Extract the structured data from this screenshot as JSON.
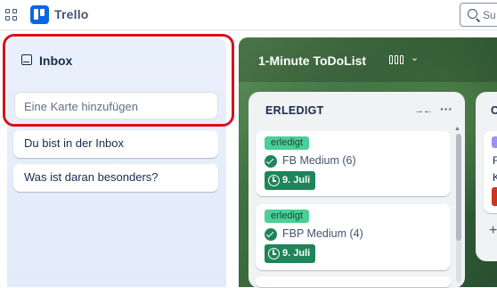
{
  "app": {
    "name": "Trello"
  },
  "search": {
    "placeholder": "Su"
  },
  "inbox": {
    "title": "Inbox",
    "add_card_placeholder": "Eine Karte hinzufügen",
    "cards": [
      "Du bist in der Inbox",
      "Was ist daran besonders?"
    ]
  },
  "board": {
    "title": "1-Minute ToDoList",
    "lists": [
      {
        "title": "ERLEDIGT",
        "cards": [
          {
            "label": "erledigt",
            "name": "FB Medium (6)",
            "due": "9. Juli"
          },
          {
            "label": "erledigt",
            "name": "FBP Medium (4)",
            "due": "9. Juli"
          }
        ]
      },
      {
        "title": "C",
        "cards": [
          {
            "line1": "F",
            "line2": "K"
          }
        ]
      }
    ]
  },
  "colors": {
    "brand": "#0c66e4",
    "highlight": "#d8101c",
    "label_done": "#4bce97",
    "due_complete": "#1f845a",
    "label_purple": "#9f8fef",
    "badge_red": "#ca3521"
  }
}
